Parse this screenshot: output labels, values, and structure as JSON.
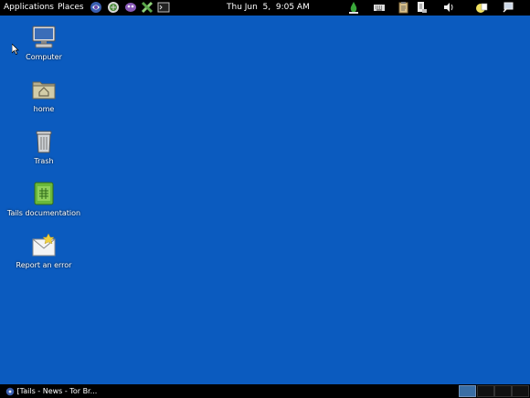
{
  "top_panel": {
    "menus": {
      "applications": "Applications",
      "places": "Places"
    },
    "launchers": [
      "tor-browser-icon",
      "network-icon",
      "pidgin-icon",
      "keepassx-icon",
      "terminal-icon"
    ],
    "clock": "Thu Jun  5,  9:05 AM",
    "tray": [
      "vidalia-onion-icon",
      "keyboard-icon",
      "clipboard-icon",
      "shutdown-icon",
      "volume-icon",
      "notification-icon",
      "network-connection-icon"
    ]
  },
  "desktop": {
    "background_color": "#0b5bbf",
    "icons": [
      {
        "label": "Computer",
        "icon": "computer-icon"
      },
      {
        "label": "home",
        "icon": "home-folder-icon"
      },
      {
        "label": "Trash",
        "icon": "trash-icon"
      },
      {
        "label": "Tails documentation",
        "icon": "documentation-icon"
      },
      {
        "label": "Report an error",
        "icon": "report-error-icon"
      }
    ]
  },
  "bottom_panel": {
    "task": "[Tails - News - Tor Br...",
    "workspaces": 4,
    "active_workspace": 1
  }
}
